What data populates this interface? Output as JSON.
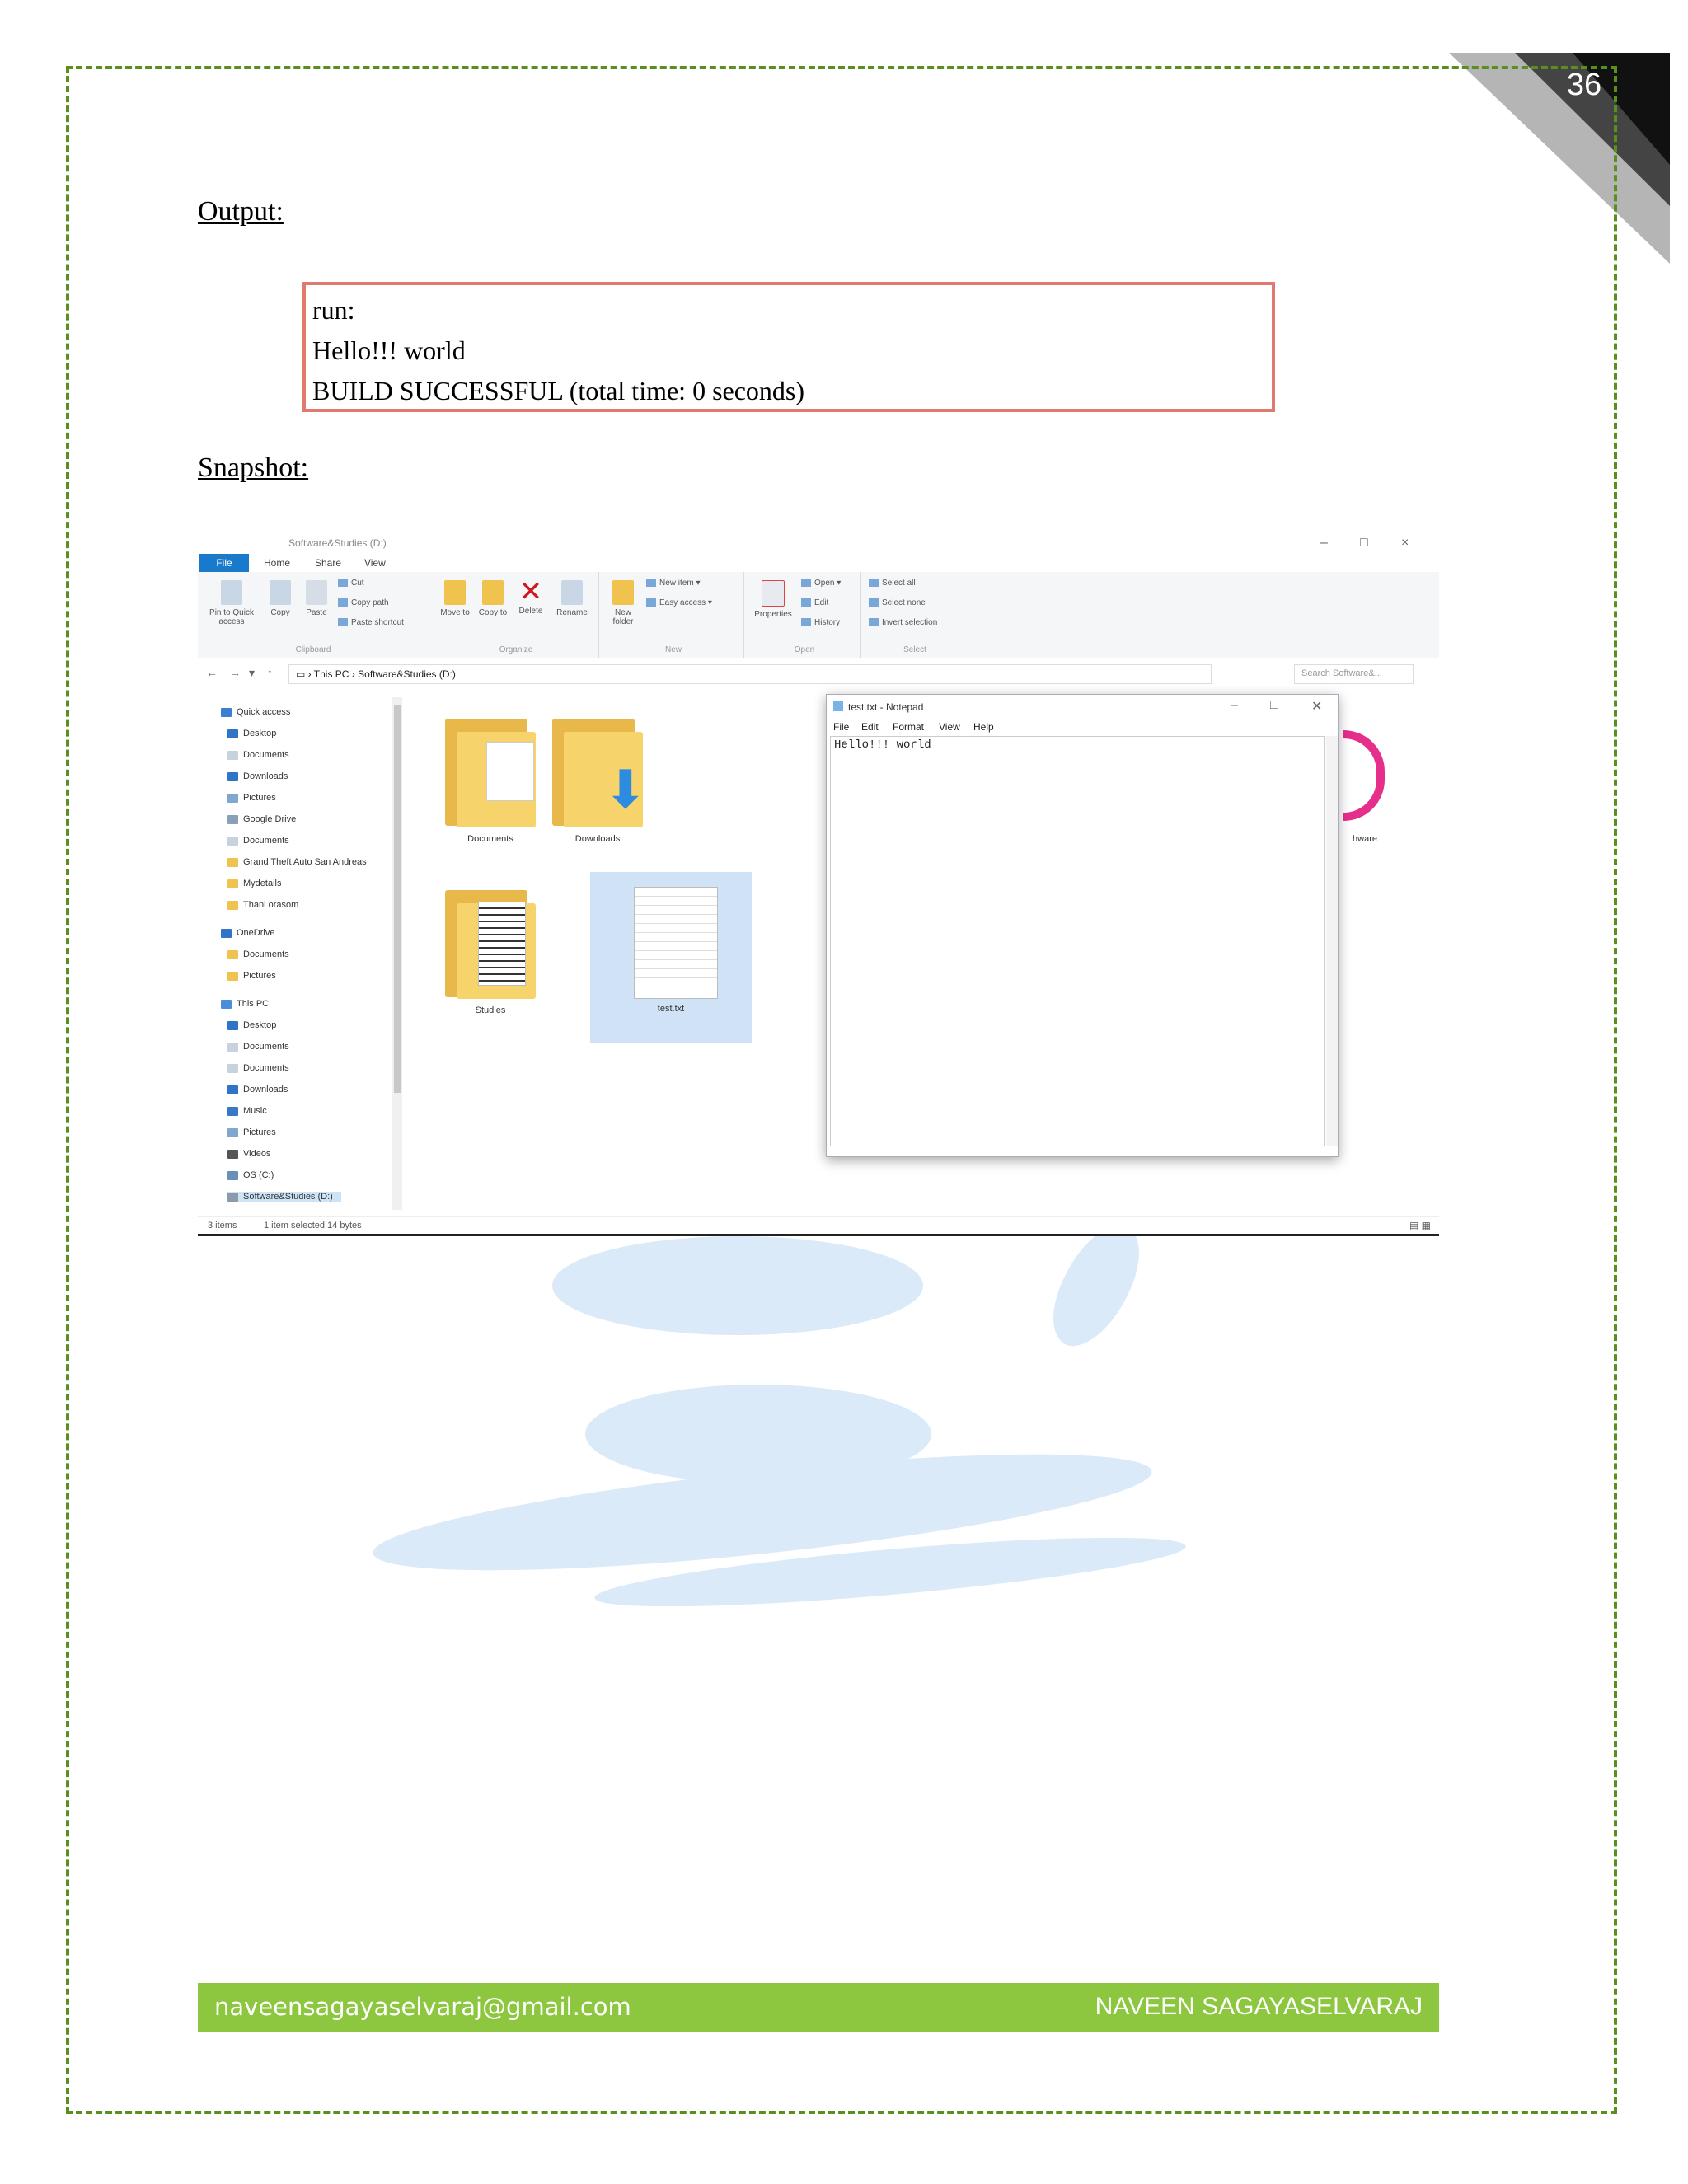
{
  "page_number": "36",
  "headings": {
    "output": "Output:",
    "snapshot": "Snapshot:"
  },
  "output_box": {
    "lines": [
      "run:",
      "Hello!!! world",
      "BUILD SUCCESSFUL (total time: 0 seconds)"
    ]
  },
  "explorer": {
    "title": "Software&Studies (D:)",
    "tabs": [
      "File",
      "Home",
      "Share",
      "View"
    ],
    "ribbon": {
      "clipboard": {
        "pin": "Pin to Quick access",
        "copy": "Copy",
        "paste": "Paste",
        "cut": "Cut",
        "copy_path": "Copy path",
        "paste_shortcut": "Paste shortcut",
        "label": "Clipboard"
      },
      "organize": {
        "move_to": "Move to",
        "copy_to": "Copy to",
        "delete": "Delete",
        "rename": "Rename",
        "label": "Organize"
      },
      "new": {
        "new_folder": "New folder",
        "new_item": "New item",
        "easy_access": "Easy access",
        "label": "New"
      },
      "open": {
        "properties": "Properties",
        "open": "Open",
        "edit": "Edit",
        "history": "History",
        "label": "Open"
      },
      "select": {
        "select_all": "Select all",
        "select_none": "Select none",
        "invert": "Invert selection",
        "label": "Select"
      }
    },
    "address": {
      "this_pc": "This PC",
      "drive": "Software&Studies (D:)",
      "search_placeholder": "Search Software&..."
    },
    "nav": {
      "quick_access": "Quick access",
      "quick_items": [
        "Desktop",
        "Documents",
        "Downloads",
        "Pictures",
        "Google Drive",
        "Documents",
        "Grand Theft Auto San Andreas",
        "Mydetails",
        "Thani orasom"
      ],
      "onedrive": "OneDrive",
      "onedrive_items": [
        "Documents",
        "Pictures"
      ],
      "this_pc": "This PC",
      "pc_items": [
        "Desktop",
        "Documents",
        "Documents",
        "Downloads",
        "Music",
        "Pictures",
        "Videos",
        "OS (C:)",
        "Software&Studies (D:)"
      ]
    },
    "files": [
      "Documents",
      "Downloads",
      "Studies",
      "test.txt",
      "hware"
    ],
    "status": {
      "items": "3 items",
      "selected": "1 item selected  14 bytes"
    }
  },
  "notepad": {
    "title": "test.txt - Notepad",
    "menu": [
      "File",
      "Edit",
      "Format",
      "View",
      "Help"
    ],
    "content": "Hello!!! world"
  },
  "footer": {
    "email": "naveensagayaselvaraj@gmail.com",
    "author": "NAVEEN SAGAYASELVARAJ"
  },
  "colors": {
    "border": "#5a8f1e",
    "footer": "#8dc63f",
    "output_border": "#e07a6e",
    "watermark": "#dbeaf9"
  }
}
